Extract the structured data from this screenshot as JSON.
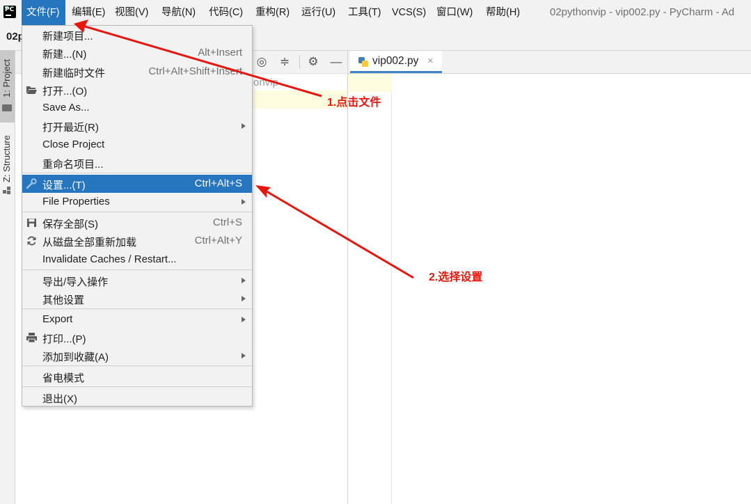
{
  "window": {
    "title": "02pythonvip - vip002.py - PyCharm - Ad",
    "project_name_partial": "02p"
  },
  "menubar": {
    "items": [
      {
        "label": "文件(F)",
        "active": true
      },
      {
        "label": "编辑(E)"
      },
      {
        "label": "视图(V)"
      },
      {
        "label": "导航(N)"
      },
      {
        "label": "代码(C)"
      },
      {
        "label": "重构(R)"
      },
      {
        "label": "运行(U)"
      },
      {
        "label": "工具(T)"
      },
      {
        "label": "VCS(S)"
      },
      {
        "label": "窗口(W)"
      },
      {
        "label": "帮助(H)"
      }
    ]
  },
  "tool_strip": {
    "project_tab": "1: Project",
    "structure_tab": "Z: Structure"
  },
  "project_panel": {
    "tree_visible_text": "onvip"
  },
  "editor": {
    "tab_label": "vip002.py",
    "tab_close": "×"
  },
  "file_menu": {
    "items": [
      {
        "label": "新建项目...",
        "shortcut": ""
      },
      {
        "label": "新建...(N)",
        "shortcut": "Alt+Insert"
      },
      {
        "label": "新建临时文件",
        "shortcut": "Ctrl+Alt+Shift+Insert"
      },
      {
        "label": "打开...(O)",
        "shortcut": "",
        "icon": "folder-open-icon"
      },
      {
        "label": "Save As...",
        "shortcut": ""
      },
      {
        "label": "打开最近(R)",
        "submenu": true
      },
      {
        "label": "Close Project",
        "shortcut": ""
      },
      {
        "label": "重命名项目...",
        "shortcut": ""
      },
      {
        "label": "设置...(T)",
        "shortcut": "Ctrl+Alt+S",
        "icon": "wrench-icon",
        "highlighted": true
      },
      {
        "label": "File Properties",
        "submenu": true
      },
      {
        "label": "保存全部(S)",
        "shortcut": "Ctrl+S",
        "icon": "save-icon"
      },
      {
        "label": "从磁盘全部重新加载",
        "shortcut": "Ctrl+Alt+Y",
        "icon": "reload-icon"
      },
      {
        "label": "Invalidate Caches / Restart...",
        "shortcut": ""
      },
      {
        "label": "导出/导入操作",
        "submenu": true
      },
      {
        "label": "其他设置",
        "submenu": true
      },
      {
        "label": "Export",
        "submenu": true
      },
      {
        "label": "打印...(P)",
        "shortcut": "",
        "icon": "printer-icon"
      },
      {
        "label": "添加到收藏(A)",
        "submenu": true
      },
      {
        "label": "省电模式",
        "shortcut": ""
      },
      {
        "label": "退出(X)",
        "shortcut": ""
      }
    ]
  },
  "annotations": {
    "step1": "1.点击文件",
    "step2": "2.选择设置",
    "color": "#e8150d"
  },
  "colors": {
    "highlight": "#2675bf",
    "menu_bg": "#f2f2f2"
  }
}
